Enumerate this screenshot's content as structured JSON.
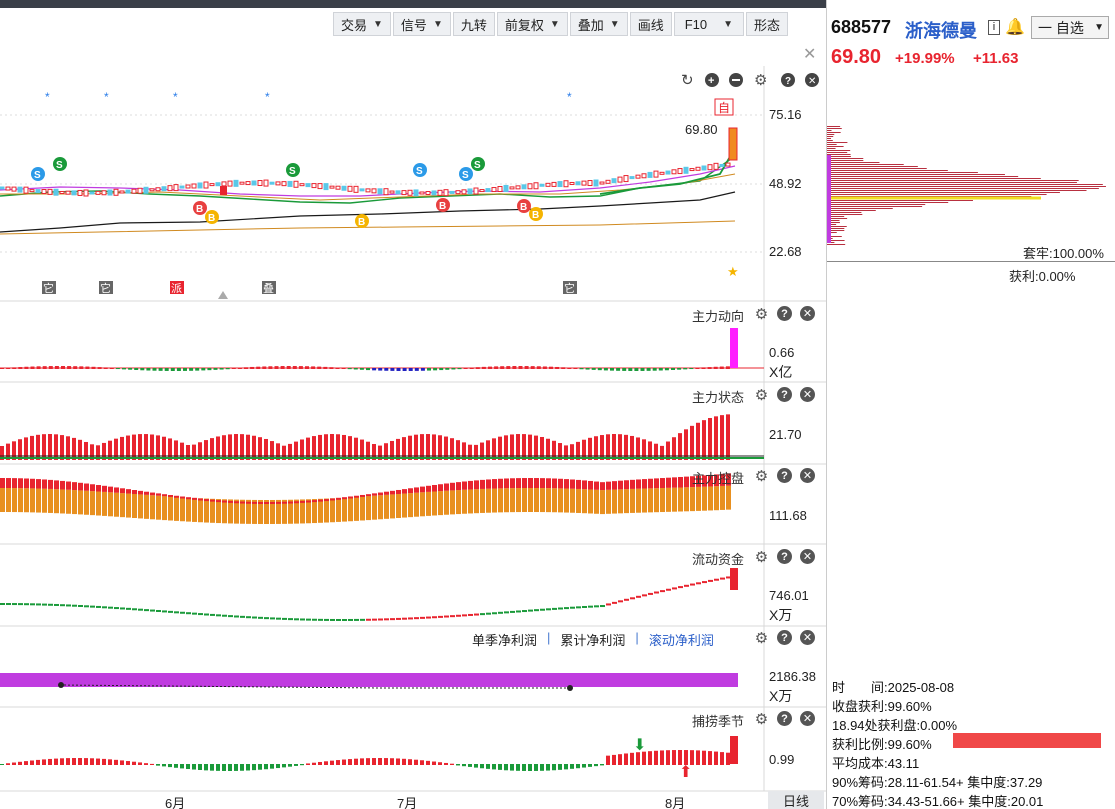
{
  "toolbar": {
    "items": [
      {
        "label": "交易",
        "dropdown": true
      },
      {
        "label": "信号",
        "dropdown": true
      },
      {
        "label": "九转",
        "dropdown": false
      },
      {
        "label": "前复权",
        "dropdown": true
      },
      {
        "label": "叠加",
        "dropdown": true
      },
      {
        "label": "画线",
        "dropdown": false
      },
      {
        "label": "F10",
        "dropdown": true
      },
      {
        "label": "形态",
        "dropdown": false
      }
    ]
  },
  "main_chart": {
    "axis_labels": [
      "75.16",
      "48.92",
      "22.68"
    ],
    "last_price_label": "69.80",
    "self_select_mark": "自",
    "event_tags": [
      "它",
      "它",
      "派",
      "叠",
      "它"
    ],
    "signal_b": "B",
    "signal_s": "S"
  },
  "panels": {
    "zldx": {
      "title": "主力动向",
      "value": "0.66",
      "unit": "X亿"
    },
    "zlzt": {
      "title": "主力状态",
      "value": "21.70"
    },
    "zlkp": {
      "title": "主力控盘",
      "value": "111.68"
    },
    "ldzj": {
      "title": "流动资金",
      "value": "746.01",
      "unit": "X万"
    },
    "profit": {
      "legend": [
        "单季净利润",
        "累计净利润",
        "滚动净利润"
      ],
      "value": "2186.38",
      "unit": "X万"
    },
    "blj": {
      "title": "捕捞季节",
      "value": "0.99"
    }
  },
  "x_axis": {
    "months": [
      "6月",
      "7月",
      "8月"
    ],
    "period": "日线"
  },
  "stock": {
    "code": "688577",
    "name": "浙海德曼",
    "info_badge": "i",
    "watch_label": "一 自选",
    "price": "69.80",
    "change_pct": "+19.99%",
    "change_abs": "+11.63"
  },
  "chip": {
    "trapped": "套牢:100.00%",
    "profit": "获利:0.00%",
    "stats": [
      "时　　间:2025-08-08",
      "收盘获利:99.60%",
      "18.94处获利盘:0.00%",
      "获利比例:99.60%",
      "平均成本:43.11",
      "90%筹码:28.11-61.54+ 集中度:37.29",
      "70%筹码:34.43-51.66+ 集中度:20.01"
    ]
  },
  "colors": {
    "up": "#e8242f",
    "down": "#1a9a3a",
    "accent": "#2b5fc9",
    "purple": "#c03ce0"
  }
}
